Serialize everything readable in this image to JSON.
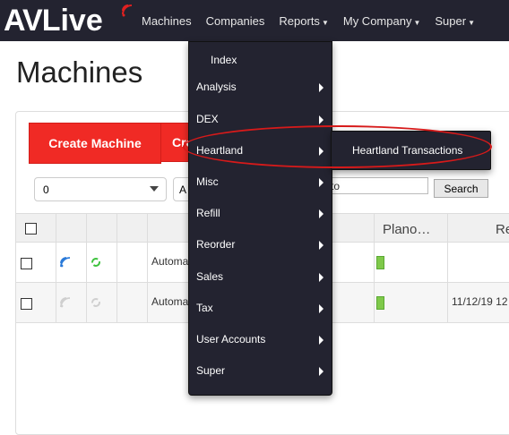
{
  "brand": {
    "logo_text_a": "AV",
    "logo_text_b": "Live"
  },
  "nav": {
    "items": [
      {
        "label": "Machines",
        "has_caret": false
      },
      {
        "label": "Companies",
        "has_caret": false
      },
      {
        "label": "Reports",
        "has_caret": true
      },
      {
        "label": "My Company",
        "has_caret": true
      },
      {
        "label": "Super",
        "has_caret": true
      }
    ]
  },
  "page": {
    "title": "Machines"
  },
  "toolbar": {
    "create_machine": "Create Machine",
    "create_partial": "Cre",
    "select_value": "0",
    "select2_value": "A",
    "search_value": "to",
    "search_button": "Search"
  },
  "table": {
    "headers": {
      "plano": "Plano…",
      "last": "Re"
    },
    "rows": [
      {
        "type": "Automa",
        "date": ""
      },
      {
        "type": "Automa",
        "date": "11/12/19 12"
      }
    ]
  },
  "menu": {
    "items": [
      {
        "label": "Index",
        "has_sub": false
      },
      {
        "label": "Analysis",
        "has_sub": true
      },
      {
        "label": "DEX",
        "has_sub": true
      },
      {
        "label": "Heartland",
        "has_sub": true
      },
      {
        "label": "Misc",
        "has_sub": true
      },
      {
        "label": "Refill",
        "has_sub": true
      },
      {
        "label": "Reorder",
        "has_sub": true
      },
      {
        "label": "Sales",
        "has_sub": true
      },
      {
        "label": "Tax",
        "has_sub": true
      },
      {
        "label": "User Accounts",
        "has_sub": true
      },
      {
        "label": "Super",
        "has_sub": true
      }
    ],
    "submenu": {
      "label": "Heartland Transactions"
    }
  },
  "colors": {
    "navbar": "#232330",
    "brand_red": "#f02a25",
    "level_green": "#7fc94a",
    "annotation_red": "#d71a1a"
  }
}
